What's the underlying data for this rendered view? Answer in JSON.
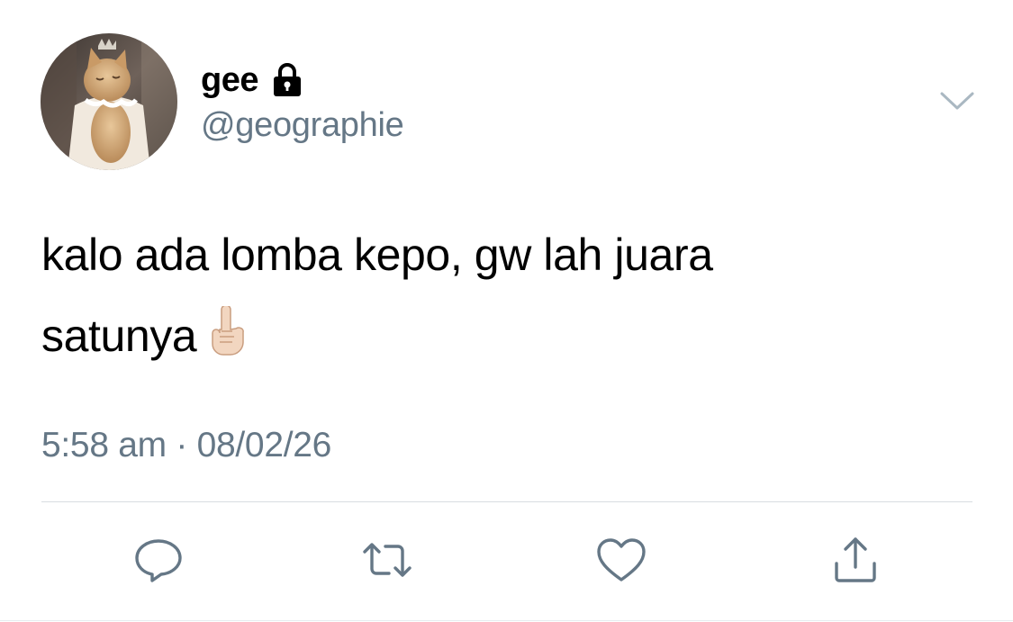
{
  "tweet": {
    "author": {
      "display_name": "gee",
      "handle": "@geographie",
      "protected_icon": "lock-icon",
      "avatar_icon": "cat-avatar"
    },
    "text_line1": "kalo ada lomba kepo, gw lah juara",
    "text_line2": "satunya",
    "emoji": "☝🏻",
    "time": "5:58 am",
    "separator": "·",
    "date": "08/02/26"
  },
  "actions": [
    "reply-icon",
    "retweet-icon",
    "like-icon",
    "share-icon"
  ],
  "colors": {
    "text": "#000000",
    "secondary": "#657786",
    "icon": "#657786",
    "divider": "#d8dde1"
  }
}
